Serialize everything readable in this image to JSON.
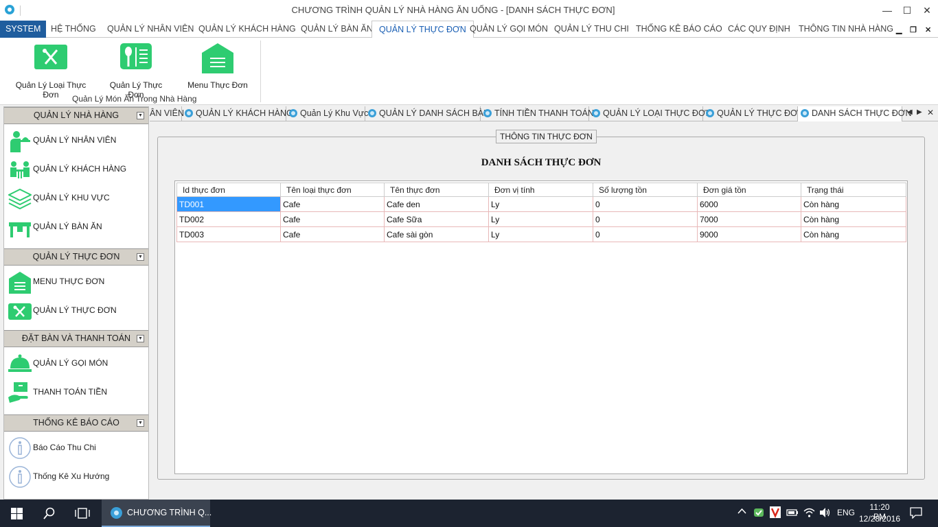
{
  "window": {
    "title": "CHƯƠNG TRÌNH QUẢN LÝ NHÀ HÀNG ĂN UỐNG - [DANH SÁCH THỰC ĐƠN]",
    "minimize": "—",
    "maximize": "☐",
    "close": "✕"
  },
  "ribbon": {
    "tabs": [
      "SYSTEM",
      "HỆ THỐNG",
      "QUẢN LÝ NHÂN VIÊN",
      "QUẢN LÝ KHÁCH HÀNG",
      "QUẢN LÝ BÀN ĂN",
      "QUẢN LÝ THỰC ĐƠN",
      "QUẢN LÝ GỌI MÓN",
      "QUẢN LÝ THU CHI",
      "THỐNG KÊ BÁO CÁO",
      "CÁC QUY ĐỊNH",
      "THÔNG TIN NHÀ HÀNG"
    ],
    "active_tab": "QUẢN LÝ THỰC ĐƠN",
    "mdi_controls": [
      "▁",
      "❐",
      "✕"
    ],
    "buttons": [
      "Quản Lý Loại Thực Đơn",
      "Quản Lý Thực Đơn",
      "Menu Thực Đơn"
    ],
    "group_label": "Quản Lý  Món Ăn Trong Nhà Hàng",
    "accent_color": "#2ecc71"
  },
  "sidebar": {
    "groups": [
      {
        "title": "QUẢN LÝ NHÀ HÀNG",
        "items": [
          "QUẢN LÝ NHÂN VIÊN",
          "QUẢN LÝ KHÁCH HÀNG",
          "QUẢN LÝ KHU VỰC",
          "QUẢN LÝ BÀN ĂN"
        ]
      },
      {
        "title": "QUẢN LÝ THỰC ĐƠN",
        "items": [
          "MENU THỰC ĐƠN",
          "QUẢN LÝ THỰC ĐƠN"
        ]
      },
      {
        "title": "ĐẶT BÀN VÀ THANH TOÁN",
        "items": [
          "QUẢN LÝ GỌI MÓN",
          "THANH TOÁN TIỀN"
        ]
      },
      {
        "title": "THỐNG KÊ BÁO CÁO",
        "items": [
          "Báo Cáo Thu Chi",
          "Thống Kê Xu Hướng"
        ]
      }
    ]
  },
  "doc_tabs": {
    "tabs": [
      "ÂN VIÊN",
      "QUẢN LÝ KHÁCH HÀNG",
      "Quản Lý Khu Vực",
      "QUẢN LÝ DANH SÁCH BÀN",
      "TÍNH TIỀN THANH TOÁN",
      "QUẢN LÝ LOẠI THỰC ĐƠN",
      "QUẢN LÝ THỰC ĐƠN",
      "DANH SÁCH THỰC ĐƠN"
    ],
    "active": "DANH SÁCH THỰC ĐƠN",
    "prev": "◀",
    "next": "▶",
    "close": "✕"
  },
  "content": {
    "group_title": "THÔNG TIN THỰC ĐƠN",
    "list_title": "DANH SÁCH  THỰC ĐƠN",
    "columns": [
      "Id thực đơn",
      "Tên loại thực đơn",
      "Tên thực đơn",
      "Đơn vị tính",
      "Số lượng tồn",
      "Đơn giá tồn",
      "Trạng thái"
    ],
    "rows": [
      [
        "TD001",
        "Cafe",
        "Cafe den",
        "Ly",
        "0",
        "6000",
        "Còn hàng"
      ],
      [
        "TD002",
        "Cafe",
        "Cafe Sữa",
        "Ly",
        "0",
        "7000",
        "Còn hàng"
      ],
      [
        "TD003",
        "Cafe",
        "Cafe sài gòn",
        "Ly",
        "0",
        "9000",
        "Còn hàng"
      ]
    ]
  },
  "taskbar": {
    "app_label": "CHƯƠNG TRÌNH Q...",
    "language": "ENG",
    "time": "11:20 PM",
    "date": "12/28/2016"
  }
}
